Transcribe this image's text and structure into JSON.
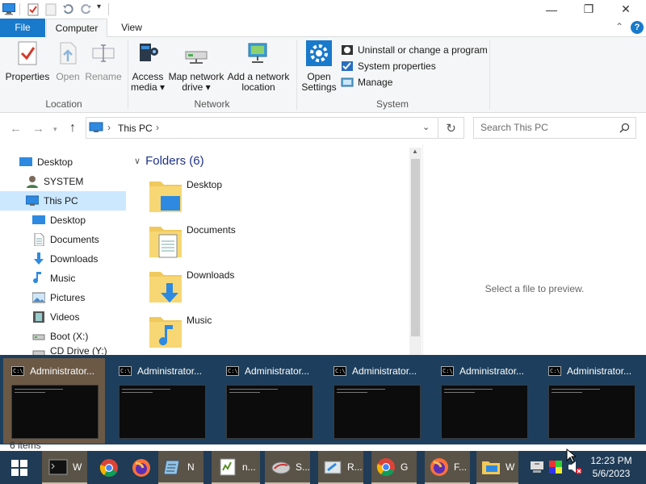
{
  "titlebar": {
    "min_glyph": "—",
    "max_glyph": "❐",
    "close_glyph": "✕"
  },
  "ribbon_tabs": {
    "file": "File",
    "computer": "Computer",
    "view": "View",
    "help_glyph": "?",
    "collapse_glyph": "⌃"
  },
  "ribbon": {
    "location": {
      "label": "Location",
      "properties": "Properties",
      "open": "Open",
      "rename": "Rename"
    },
    "network": {
      "label": "Network",
      "access_media": "Access media ▾",
      "map_drive_1": "Map network",
      "map_drive_2": "drive ▾",
      "add_loc_1": "Add a network",
      "add_loc_2": "location"
    },
    "system": {
      "label": "System",
      "open_settings_1": "Open",
      "open_settings_2": "Settings",
      "uninstall": "Uninstall or change a program",
      "system_properties": "System properties",
      "manage": "Manage"
    }
  },
  "address": {
    "path": "This PC",
    "sep": "›",
    "search_placeholder": "Search This PC"
  },
  "nav": {
    "items": [
      {
        "label": "Desktop",
        "icon": "desktop-icon"
      },
      {
        "label": "SYSTEM",
        "icon": "user-icon"
      },
      {
        "label": "This PC",
        "icon": "computer-icon"
      },
      {
        "label": "Desktop",
        "icon": "desktop-icon"
      },
      {
        "label": "Documents",
        "icon": "documents-icon"
      },
      {
        "label": "Downloads",
        "icon": "downloads-icon"
      },
      {
        "label": "Music",
        "icon": "music-icon"
      },
      {
        "label": "Pictures",
        "icon": "pictures-icon"
      },
      {
        "label": "Videos",
        "icon": "videos-icon"
      },
      {
        "label": "Boot (X:)",
        "icon": "drive-icon"
      },
      {
        "label": "CD Drive (Y:) UBC",
        "icon": "cd-drive-icon"
      }
    ]
  },
  "content": {
    "group_header": "Folders (6)",
    "folders": [
      "Desktop",
      "Documents",
      "Downloads",
      "Music"
    ]
  },
  "preview": {
    "text": "Select a file to preview."
  },
  "alttab": {
    "items": [
      "Administrator...",
      "Administrator...",
      "Administrator...",
      "Administrator...",
      "Administrator...",
      "Administrator..."
    ],
    "icon_text": "C:\\"
  },
  "statusbar": {
    "text": "6 items"
  },
  "taskbar": {
    "start_icon": "windows-logo-icon",
    "items": [
      {
        "label": "W",
        "icon": "cmd-icon"
      },
      {
        "label": "",
        "icon": "chrome-icon"
      },
      {
        "label": "",
        "icon": "firefox-icon"
      },
      {
        "label": "N",
        "icon": "notepad-icon"
      },
      {
        "label": "n...",
        "icon": "editor-icon"
      },
      {
        "label": "S...",
        "icon": "tool-icon"
      },
      {
        "label": "R...",
        "icon": "run-icon"
      },
      {
        "label": "G",
        "icon": "chrome-icon"
      },
      {
        "label": "F...",
        "icon": "firefox-icon"
      },
      {
        "label": "W",
        "icon": "explorer-icon"
      }
    ],
    "time": "12:23 PM",
    "date": "5/6/2023"
  },
  "colors": {
    "accent": "#1979ca",
    "taskbar": "#1f3b56",
    "alttab": "#1d3f5d",
    "selection": "#cce8ff"
  }
}
